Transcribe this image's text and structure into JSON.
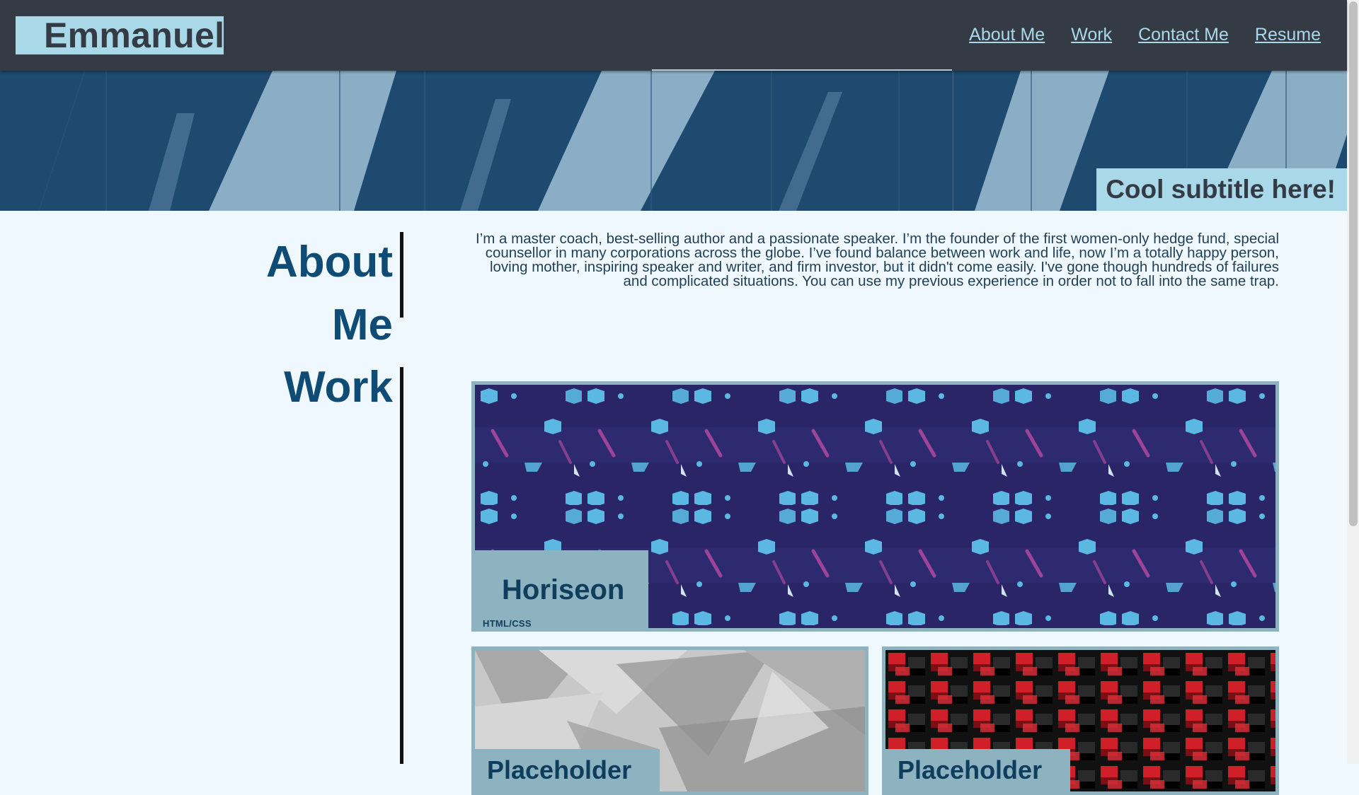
{
  "header": {
    "logo": "Emmanuel",
    "nav": [
      "About Me",
      "Work",
      "Contact Me",
      "Resume"
    ]
  },
  "hero": {
    "subtitle": "Cool subtitle here!"
  },
  "about": {
    "heading_line1": "About",
    "heading_line2": "Me",
    "text": "I’m a master coach, best-selling author and a passionate speaker. I’m the founder of the first women-only hedge fund, special counsellor in many corporations across the globe. I’ve found balance between work and life, now I’m a totally happy person, loving mother, inspiring speaker and writer, and firm investor, but it didn't come easily. I've gone though hundreds of failures and complicated situations. You can use my previous experience in order not to fall into the same trap."
  },
  "work": {
    "heading": "Work",
    "projects": [
      {
        "title": "Horiseon",
        "tech": "HTML/CSS"
      },
      {
        "title": "Placeholder",
        "tech": ""
      },
      {
        "title": "Placeholder",
        "tech": ""
      }
    ]
  },
  "colors": {
    "header_bg": "#353b44",
    "accent": "#a9d8e8",
    "heading": "#0f4c75",
    "page_bg": "#f0f8ff",
    "card_border": "#8db3c1"
  }
}
